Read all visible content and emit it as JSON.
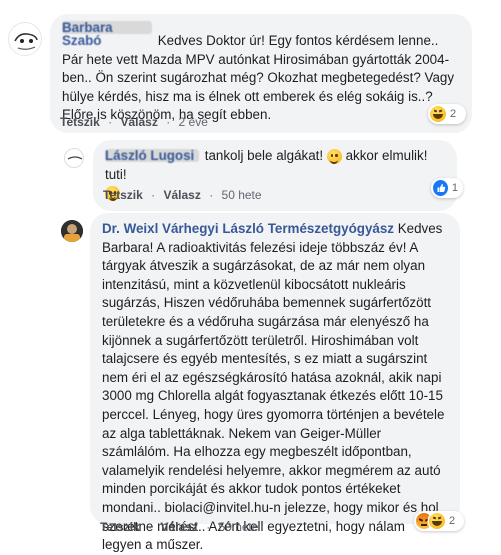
{
  "comments": [
    {
      "author": "Barbara Szabó",
      "text": "Kedves Doktor úr! Egy fontos kérdésem lenne.. Pár hete vett Mazda MPV autónkat Hirosimában gyártották 2004-ben.. Ön szerint sugározhat még? Okozhat megbetegedést? Vagy hülye kérdés, hisz ma is élnek ott emberek és elég sokáig is..? Előre is köszönöm, ha segít ebben.",
      "like": "Tetszik",
      "reply": "Válasz",
      "time": "2 éve",
      "reaction_count": "2",
      "reaction_icons": [
        "laughing-face-icon"
      ]
    },
    {
      "author": "László Lugosi",
      "text": "tankolj bele algákat!",
      "text_after": "akkor elmulik! tuti!",
      "like": "Tetszik",
      "reply": "Válasz",
      "time": "50 hete",
      "reaction_count": "1",
      "reaction_icons": [
        "like-thumb-icon"
      ]
    },
    {
      "author": "Dr. Weixl Várhegyi László Természetgyógyász",
      "text": "Kedves Barbara! A radioaktivitás felezési ideje többszáz év! A tárgyak átveszik a sugárzásokat, de az már nem olyan intenzitású, mint a közvetlenül kibocsátott nukleáris sugárzás, Hiszen védőruhába bemennek sugárfertőzött területekre és a védőruha sugárzása már elenyésző ha kijönnek a sugárfertőzött területről. Hiroshimában volt talajcsere és egyéb mentesítés, s ez miatt a sugárszint nem éri el az egészségkárosító hatása azoknál, akik napi 3000 mg Chlorella algát fogyasztanak étkezés előtt 10-15 perccel. Lényeg, hogy üres gyomorra történjen a bevétele az alga tablettáknak. Nekem van Geiger-Müller számlálóm. Ha elhozza egy megbeszélt időpontban, valamelyik rendelési helyemre, akkor megmérem az autó minden porcikáját és akkor tudok pontos értékeket mondani.. biolaci@invitel.hu-n jelezze, hogy mikor és hol szeretne mérést.. Azért kell egyeztetni, hogy nálam legyen a műszer.",
      "like": "Tetszik",
      "reply": "Válasz",
      "time": "50 hete",
      "reaction_count": "2",
      "reaction_icons": [
        "angry-face-icon",
        "laughing-face-icon"
      ]
    }
  ],
  "separator": "·",
  "colors": {
    "link": "#385898",
    "bubble": "#f2f3f5",
    "meta": "#606770",
    "like_blue": "#1877f2",
    "angry_top": "#e9710f",
    "angry_bottom": "#f7c84a"
  }
}
